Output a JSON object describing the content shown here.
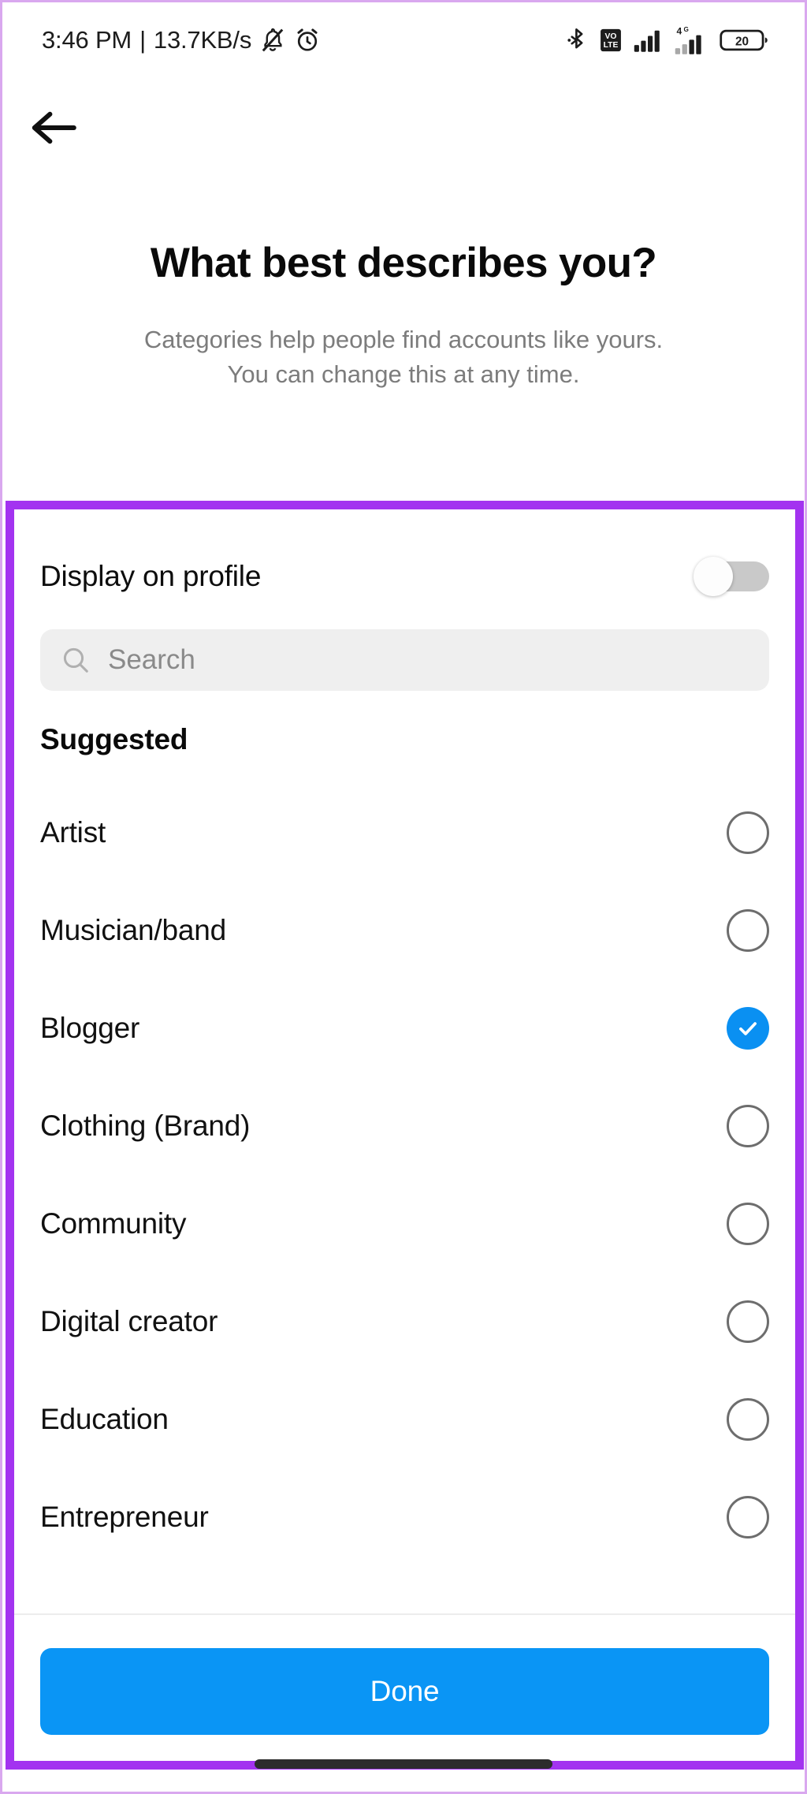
{
  "status_bar": {
    "time": "3:46 PM",
    "separator": "|",
    "network_speed": "13.7KB/s",
    "icons_left": [
      "mute-bell-icon",
      "alarm-clock-icon"
    ],
    "icons_right": [
      "bluetooth-icon",
      "vowifi-icon",
      "signal-bars-icon",
      "4g-signal-icon",
      "battery-icon"
    ],
    "network_type": "4G",
    "battery_level": "20"
  },
  "nav": {
    "back_icon": "back-arrow-icon"
  },
  "header": {
    "title": "What best describes you?",
    "subtitle_line1": "Categories help people find accounts like yours.",
    "subtitle_line2": "You can change this at any time."
  },
  "sheet": {
    "display_on_profile": {
      "label": "Display on profile",
      "toggle_state": "off"
    },
    "search": {
      "placeholder": "Search",
      "value": "",
      "icon": "search-icon"
    },
    "section_header": "Suggested",
    "categories": [
      {
        "label": "Artist",
        "selected": false
      },
      {
        "label": "Musician/band",
        "selected": false
      },
      {
        "label": "Blogger",
        "selected": true
      },
      {
        "label": "Clothing (Brand)",
        "selected": false
      },
      {
        "label": "Community",
        "selected": false
      },
      {
        "label": "Digital creator",
        "selected": false
      },
      {
        "label": "Education",
        "selected": false
      },
      {
        "label": "Entrepreneur",
        "selected": false
      }
    ],
    "done_button": "Done"
  },
  "colors": {
    "highlight_border": "#a333f0",
    "page_border": "#d9a8ef",
    "accent_blue": "#0a95f5",
    "selected_blue": "#0a90f2",
    "search_bg": "#efefef",
    "toggle_track_off": "#c9c9c9",
    "subtitle_gray": "#7c7c7c"
  }
}
